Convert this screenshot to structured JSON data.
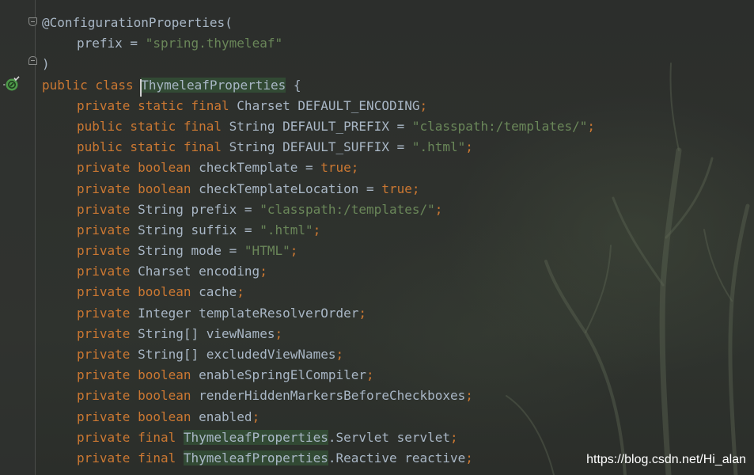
{
  "colors": {
    "keyword": "#cc7832",
    "string": "#6a8759",
    "identifier": "#a9b7c6",
    "background": "#2b2d2b",
    "reference_highlight": "#344f36"
  },
  "gutter": {
    "fold_icon": "fold-icon",
    "marker_icon": "spring-bean-icon"
  },
  "code": {
    "l1": {
      "ann": "@ConfigurationProperties",
      "paren": "("
    },
    "l2": {
      "name": "prefix",
      "eq": " = ",
      "value": "\"spring.thymeleaf\""
    },
    "l3": {
      "paren": ")"
    },
    "l4": {
      "kw": "public class ",
      "name": "ThymeleafProperties",
      "rest": " {"
    },
    "l5": {
      "kw": "private static final ",
      "type": "Charset DEFAULT_ENCODING",
      "semi": ";"
    },
    "l6": {
      "kw": "public static final ",
      "type": "String DEFAULT_PREFIX = ",
      "value": "\"classpath:/templates/\"",
      "semi": ";"
    },
    "l7": {
      "kw": "public static final ",
      "type": "String DEFAULT_SUFFIX = ",
      "value": "\".html\"",
      "semi": ";"
    },
    "l8": {
      "kw": "private boolean ",
      "name": "checkTemplate = ",
      "value": "true",
      "semi": ";"
    },
    "l9": {
      "kw": "private boolean ",
      "name": "checkTemplateLocation = ",
      "value": "true",
      "semi": ";"
    },
    "l10": {
      "kw": "private ",
      "type": "String prefix = ",
      "value": "\"classpath:/templates/\"",
      "semi": ";"
    },
    "l11": {
      "kw": "private ",
      "type": "String suffix = ",
      "value": "\".html\"",
      "semi": ";"
    },
    "l12": {
      "kw": "private ",
      "type": "String mode = ",
      "value": "\"HTML\"",
      "semi": ";"
    },
    "l13": {
      "kw": "private ",
      "type": "Charset encoding",
      "semi": ";"
    },
    "l14": {
      "kw": "private boolean ",
      "name": "cache",
      "semi": ";"
    },
    "l15": {
      "kw": "private ",
      "type": "Integer templateResolverOrder",
      "semi": ";"
    },
    "l16": {
      "kw": "private ",
      "type": "String[] viewNames",
      "semi": ";"
    },
    "l17": {
      "kw": "private ",
      "type": "String[] excludedViewNames",
      "semi": ";"
    },
    "l18": {
      "kw": "private boolean ",
      "name": "enableSpringElCompiler",
      "semi": ";"
    },
    "l19": {
      "kw": "private boolean ",
      "name": "renderHiddenMarkersBeforeCheckboxes",
      "semi": ";"
    },
    "l20": {
      "kw": "private boolean ",
      "name": "enabled",
      "semi": ";"
    },
    "l21": {
      "kw": "private final ",
      "ref": "ThymeleafProperties",
      "rest": ".Servlet servlet",
      "semi": ";"
    },
    "l22": {
      "kw": "private final ",
      "ref": "ThymeleafProperties",
      "rest": ".Reactive reactive",
      "semi": ";"
    }
  },
  "watermark": "https://blog.csdn.net/Hi_alan"
}
